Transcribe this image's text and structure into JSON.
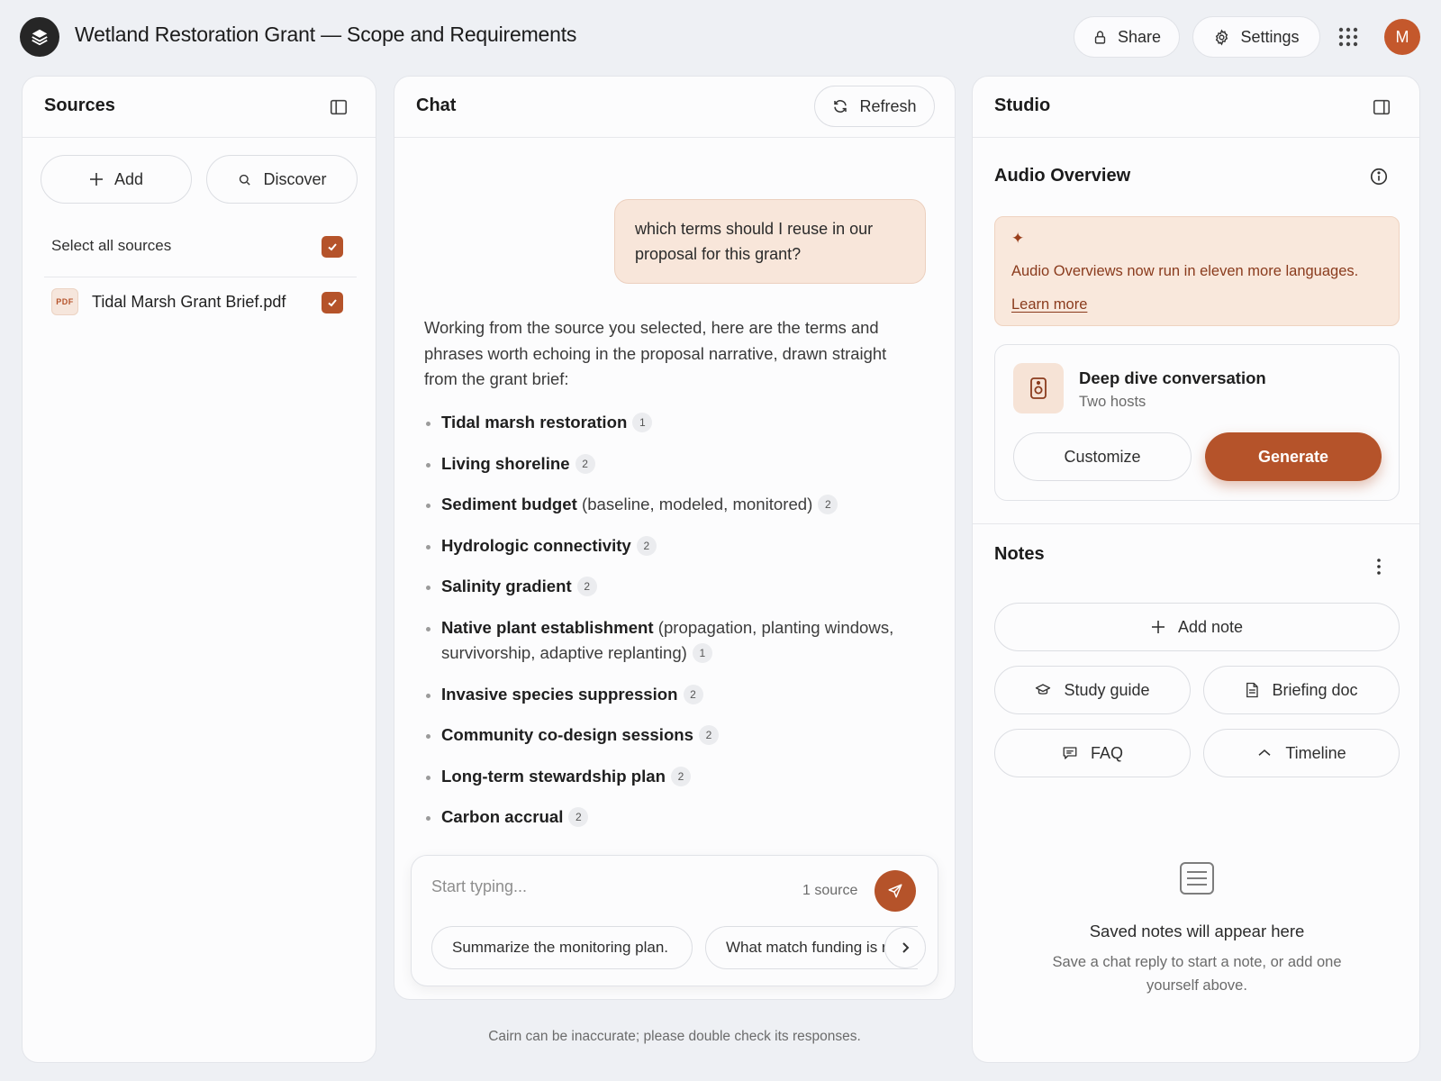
{
  "header": {
    "title": "Wetland Restoration Grant — Scope and Requirements",
    "share_label": "Share",
    "settings_label": "Settings",
    "avatar_initial": "M",
    "icons": [
      "layers-logo-icon",
      "lock-icon",
      "gear-icon",
      "apps-grid-icon"
    ]
  },
  "sources": {
    "title": "Sources",
    "add_label": "Add",
    "discover_label": "Discover",
    "select_all_label": "Select all sources",
    "select_all_checked": true,
    "items": [
      {
        "badge": "PDF",
        "name": "Tidal Marsh Grant Brief.pdf",
        "checked": true
      }
    ]
  },
  "chat": {
    "title": "Chat",
    "refresh_label": "Refresh",
    "user_message": "which terms should I reuse in our proposal for this grant?",
    "answer_intro": "Working from the source you selected, here are the terms and phrases worth echoing in the proposal narrative, drawn straight from the grant brief:",
    "terms": [
      {
        "name": "Tidal marsh restoration",
        "detail": "",
        "cite": "1"
      },
      {
        "name": "Living shoreline",
        "detail": "",
        "cite": "2"
      },
      {
        "name": "Sediment budget",
        "detail": "(baseline, modeled, monitored)",
        "cite": "2"
      },
      {
        "name": "Hydrologic connectivity",
        "detail": "",
        "cite": "2"
      },
      {
        "name": "Salinity gradient",
        "detail": "",
        "cite": "2"
      },
      {
        "name": "Native plant establishment",
        "detail": "(propagation, planting windows, survivorship, adaptive replanting)",
        "cite": "1"
      },
      {
        "name": "Invasive species suppression",
        "detail": "",
        "cite": "2"
      },
      {
        "name": "Community co-design sessions",
        "detail": "",
        "cite": "2"
      },
      {
        "name": "Long-term stewardship plan",
        "detail": "",
        "cite": "2"
      },
      {
        "name": "Carbon accrual",
        "detail": "",
        "cite": "2"
      }
    ],
    "input_placeholder": "Start typing...",
    "source_count": "1 source",
    "suggestions": [
      "Summarize the monitoring plan.",
      "What match funding is required?"
    ],
    "disclaimer": "Cairn can be inaccurate; please double check its responses."
  },
  "studio": {
    "title": "Studio",
    "audio_overview_title": "Audio Overview",
    "announcement": {
      "text": "Audio Overviews now run in eleven more languages.",
      "link": "Learn more"
    },
    "deep_dive": {
      "title": "Deep dive conversation",
      "subtitle": "Two hosts",
      "customize_label": "Customize",
      "generate_label": "Generate"
    },
    "notes_title": "Notes",
    "add_note_label": "Add note",
    "tools": {
      "study_guide": "Study guide",
      "briefing_doc": "Briefing doc",
      "faq": "FAQ",
      "timeline": "Timeline"
    },
    "empty_title": "Saved notes will appear here",
    "empty_subtitle": "Save a chat reply to start a note, or add one yourself above."
  },
  "colors": {
    "accent": "#b5532a",
    "accent_soft": "#f8e6da",
    "background": "#eef0f4",
    "panel": "#fcfcfd"
  }
}
